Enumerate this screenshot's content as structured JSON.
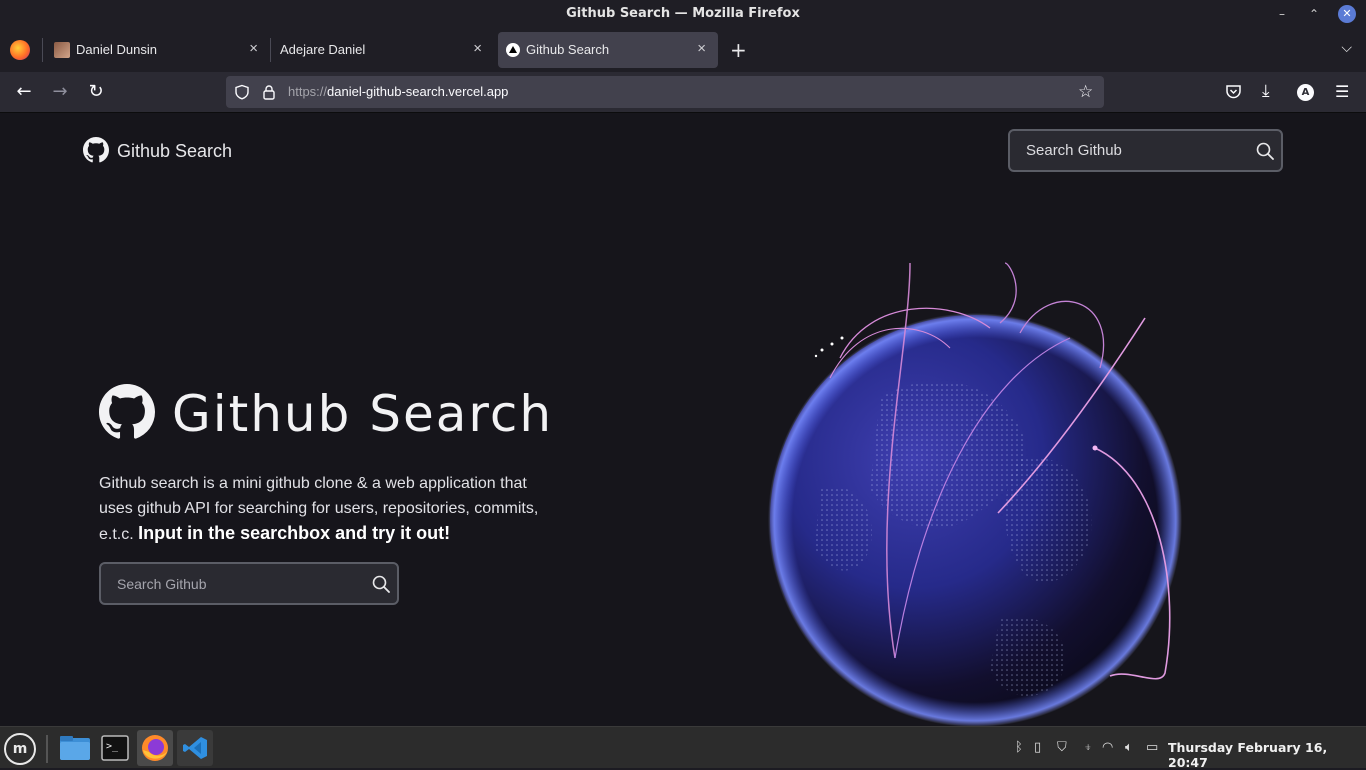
{
  "window": {
    "title": "Github Search — Mozilla Firefox"
  },
  "tabs": [
    {
      "label": "Daniel Dunsin"
    },
    {
      "label": "Adejare Daniel"
    },
    {
      "label": "Github Search"
    }
  ],
  "navbar": {
    "url_scheme": "https://",
    "url_host": "daniel-github-search.vercel.app"
  },
  "site": {
    "brand": "Github Search",
    "header_search_placeholder": "Search Github",
    "hero_title": "Github Search",
    "hero_desc": "Github search is a mini github clone & a web application that uses github API for searching for users, repositories, commits, e.t.c.",
    "hero_cta": "Input in the searchbox and try it out!",
    "hero_search_placeholder": "Search Github"
  },
  "taskbar": {
    "clock": "Thursday February 16, 20:47"
  },
  "icons": {
    "close": "×",
    "new_tab": "+",
    "tab_list": "⌵",
    "back": "←",
    "forward": "→",
    "reload": "↻",
    "bookmark": "☆",
    "download": "⤓",
    "menu": "☰",
    "account_initial": "A"
  }
}
